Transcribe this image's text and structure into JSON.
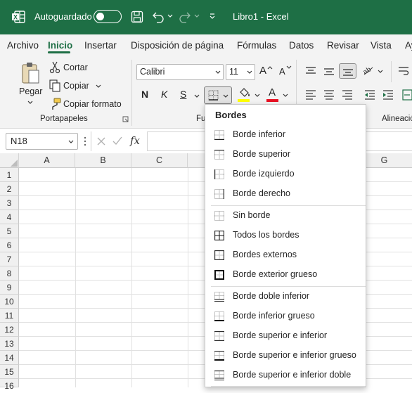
{
  "titlebar": {
    "autosave_label": "Autoguardado",
    "document_title": "Libro1  -  Excel"
  },
  "tabs": [
    "Archivo",
    "Inicio",
    "Insertar",
    "Disposición de página",
    "Fórmulas",
    "Datos",
    "Revisar",
    "Vista",
    "Ay"
  ],
  "clipboard": {
    "paste_label": "Pegar",
    "cut_label": "Cortar",
    "copy_label": "Copiar",
    "format_painter_label": "Copiar formato",
    "group_label": "Portapapeles"
  },
  "font": {
    "name": "Calibri",
    "size": "11",
    "group_label_partial": "Fu",
    "bold": "N",
    "italic": "K",
    "underline": "S",
    "grow": "A",
    "shrink": "A",
    "font_color_letter": "A"
  },
  "alignment": {
    "group_label": "Alineació"
  },
  "formula_bar": {
    "name_box": "N18",
    "fx": "fx"
  },
  "grid": {
    "columns": [
      "A",
      "B",
      "C",
      "G"
    ],
    "rows": [
      "1",
      "2",
      "3",
      "4",
      "5",
      "6",
      "7",
      "8",
      "9",
      "10",
      "11",
      "12",
      "13",
      "14",
      "15",
      "16"
    ]
  },
  "borders_menu": {
    "title": "Bordes",
    "items": [
      "Borde inferior",
      "Borde superior",
      "Borde izquierdo",
      "Borde derecho",
      "Sin borde",
      "Todos los bordes",
      "Bordes externos",
      "Borde exterior grueso",
      "Borde doble inferior",
      "Borde inferior grueso",
      "Borde superior e inferior",
      "Borde superior e inferior grueso",
      "Borde superior e inferior doble"
    ]
  },
  "colors": {
    "excel_green": "#1e6f45",
    "ribbon_bg": "#f3f3f3",
    "highlight_yellow": "#ffff00",
    "font_red": "#e81123"
  }
}
